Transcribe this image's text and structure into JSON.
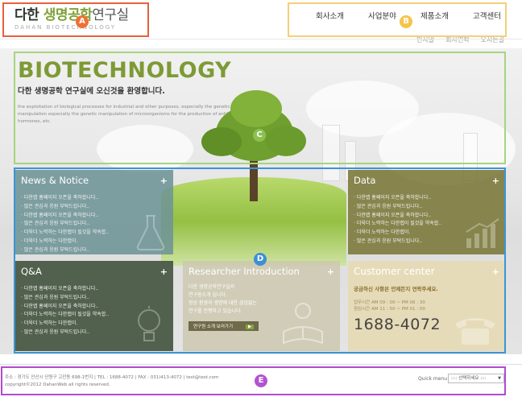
{
  "header": {
    "logo": {
      "title_prefix": "다한 ",
      "title_highlight": "생명공학",
      "title_suffix": "연구실",
      "subtitle": "DAHAN BIOTECHNOLOGY"
    },
    "nav": {
      "main": [
        "회사소개",
        "사업분야",
        "제품소개",
        "고객센터"
      ],
      "sub": [
        "인사말",
        "회사연혁",
        "오시는길"
      ]
    }
  },
  "markers": {
    "a": "A",
    "b": "B",
    "c": "C",
    "d": "D",
    "e": "E"
  },
  "hero": {
    "title": "BIOTECHNOLOGY",
    "subtitle": "다한 생명공학 연구실에 오신것을 환영합니다.",
    "description": "the exploitation of biological processes for industrial and other purposes, especially the genetic manipulation especially the genetic manipulation of microorganisms for the production of antibiotics, hormones, etc."
  },
  "panels": {
    "news": {
      "title": "News & Notice",
      "plus": "+",
      "items": [
        "다한랩 홈페이지 오픈을 축하합니다..",
        "많은 관심과 응원 부탁드립니다..",
        "다한랩 홈페이지 오픈을 축하합니다..",
        "많은 관심과 응원 부탁드립니다..",
        "더욱더 노력하는 다한랩이 될것을 약속합..",
        "더욱더 노력하는 다한랩이.",
        "많은 관심과 응원 부탁드립니다.."
      ]
    },
    "data": {
      "title": "Data",
      "plus": "+",
      "items": [
        "다한랩 홈페이지 오픈을 축하합니다..",
        "많은 관심과 응원 부탁드립니다..",
        "다한랩 홈페이지 오픈을 축하합니다..",
        "더욱더 노력하는 다한랩이 될것을 약속합..",
        "더욱더 노력하는 다한랩이.",
        "많은 관심과 응원 부탁드립니다.."
      ]
    },
    "qa": {
      "title": "Q&A",
      "plus": "+",
      "items": [
        "다한랩 홈페이지 오픈을 축하합니다..",
        "많은 관심과 응원 부탁드립니다..",
        "다한랩 홈페이지 오픈을 축하합니다..",
        "더욱더 노력하는 다한랩이 될것을 약속합..",
        "더욱더 노력하는 다한랩이.",
        "많은 관심과 응원 부탁드립니다.."
      ]
    },
    "research": {
      "title": "Researcher Introduction",
      "plus": "+",
      "lines": [
        "다한 생명공학연구실의",
        "연구원소개 입니다.",
        "항상 환경과 생명에 대한 끊임없는",
        "연구를 진행하고 있습니다."
      ],
      "button": "연구원 소개 보러가기",
      "button_arrow": "▶"
    },
    "customer": {
      "title": "Customer center",
      "plus": "+",
      "question": "궁금하신 사항은 언제든지 연락주세요.",
      "hours": [
        "업무시간 AM 09 : 00 ~ PM 06 : 30",
        "점심시간 AM 11 : 50 ~ PM 01 : 00"
      ],
      "phone": "1688-4072"
    }
  },
  "footer": {
    "address": "주소 : 경기도 안산시 단원구 고잔동 698-1번지 | TEL : 1688-4072 | FAX : 031)413-4072 | test@test.com",
    "copyright": "copyright©2012 DahanWeb all rights reserved.",
    "quick_menu_label": "Quick menu",
    "quick_select_value": ":::: 선택하세요 ::::",
    "quick_select_caret": "▼"
  }
}
